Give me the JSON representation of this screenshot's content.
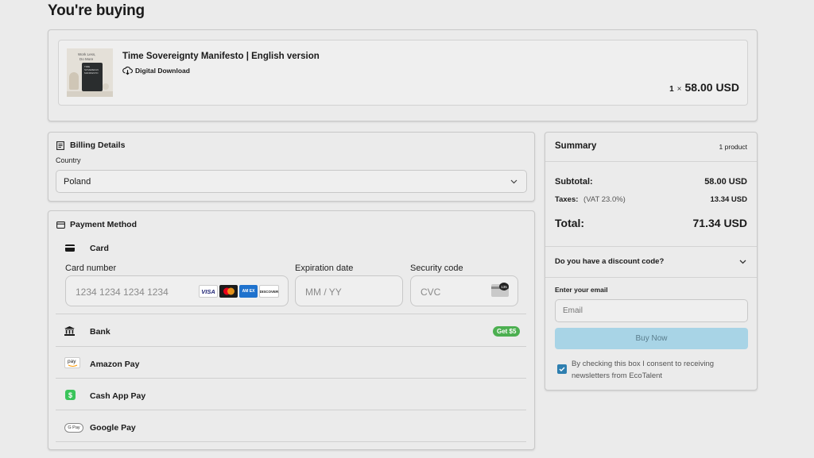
{
  "page": {
    "title": "You're buying"
  },
  "product": {
    "name": "Time Sovereignty Manifesto | English version",
    "type": "Digital Download",
    "quantity": "1",
    "multiply": "×",
    "price": "58.00 USD",
    "thumb_text_line1": "Work Less,",
    "thumb_text_line2": "Do More",
    "thumb_book_title": "TIME SOVEREIGNTY MANIFESTO"
  },
  "billing": {
    "title": "Billing Details",
    "country_label": "Country",
    "country_value": "Poland"
  },
  "payment": {
    "title": "Payment Method",
    "card_label": "Card",
    "card_number_label": "Card number",
    "card_number_placeholder": "1234 1234 1234 1234",
    "expiry_label": "Expiration date",
    "expiry_placeholder": "MM / YY",
    "cvc_label": "Security code",
    "cvc_placeholder": "CVC",
    "cvc_icon_text": "135",
    "brands": {
      "visa": "VISA",
      "amex": "AM EX",
      "discover": "DISCOVER"
    },
    "methods": [
      {
        "label": "Bank",
        "badge": "Get $5"
      },
      {
        "label": "Amazon Pay",
        "icon_text": "pay"
      },
      {
        "label": "Cash App Pay",
        "icon_text": "$"
      },
      {
        "label": "Google Pay",
        "icon_text": "G Pay"
      }
    ]
  },
  "summary": {
    "title": "Summary",
    "count": "1 product",
    "subtotal_label": "Subtotal:",
    "subtotal_value": "58.00 USD",
    "taxes_label": "Taxes:",
    "taxes_detail": "(VAT 23.0%)",
    "taxes_value": "13.34 USD",
    "total_label": "Total:",
    "total_value": "71.34 USD",
    "discount_label": "Do you have a discount code?",
    "email_label": "Enter your email",
    "email_placeholder": "Email",
    "buy_label": "Buy Now",
    "consent_text_1": "By checking this box I consent to receiving",
    "consent_text_2": "newsletters from EcoTalent"
  },
  "colors": {
    "badge_green": "#4caf50",
    "buy_button": "#a8d4e6",
    "checkbox": "#2e7fb0",
    "cashapp": "#3ac45a"
  }
}
